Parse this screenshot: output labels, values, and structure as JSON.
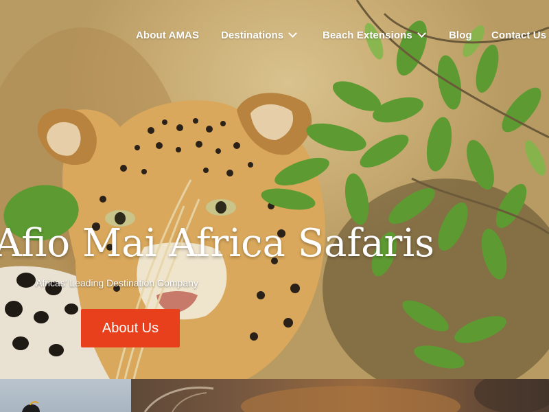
{
  "nav": {
    "items": [
      {
        "label": "About AMAS",
        "has_dropdown": false
      },
      {
        "label": "Destinations",
        "has_dropdown": true
      },
      {
        "label": "Beach Extensions",
        "has_dropdown": true
      },
      {
        "label": "Blog",
        "has_dropdown": false
      },
      {
        "label": "Contact Us",
        "has_dropdown": false
      }
    ]
  },
  "hero": {
    "title": "o Afio Mai Africa Safaris",
    "subtitle": "Africas' Leading Destination Company",
    "cta_label": "About Us",
    "image_subject": "leopard among green leaves"
  },
  "strip": {
    "items": [
      {
        "image_subject": "bird against pale sky"
      },
      {
        "image_subject": "lion fur close-up"
      }
    ]
  },
  "colors": {
    "accent": "#e8401c",
    "text": "#ffffff"
  }
}
